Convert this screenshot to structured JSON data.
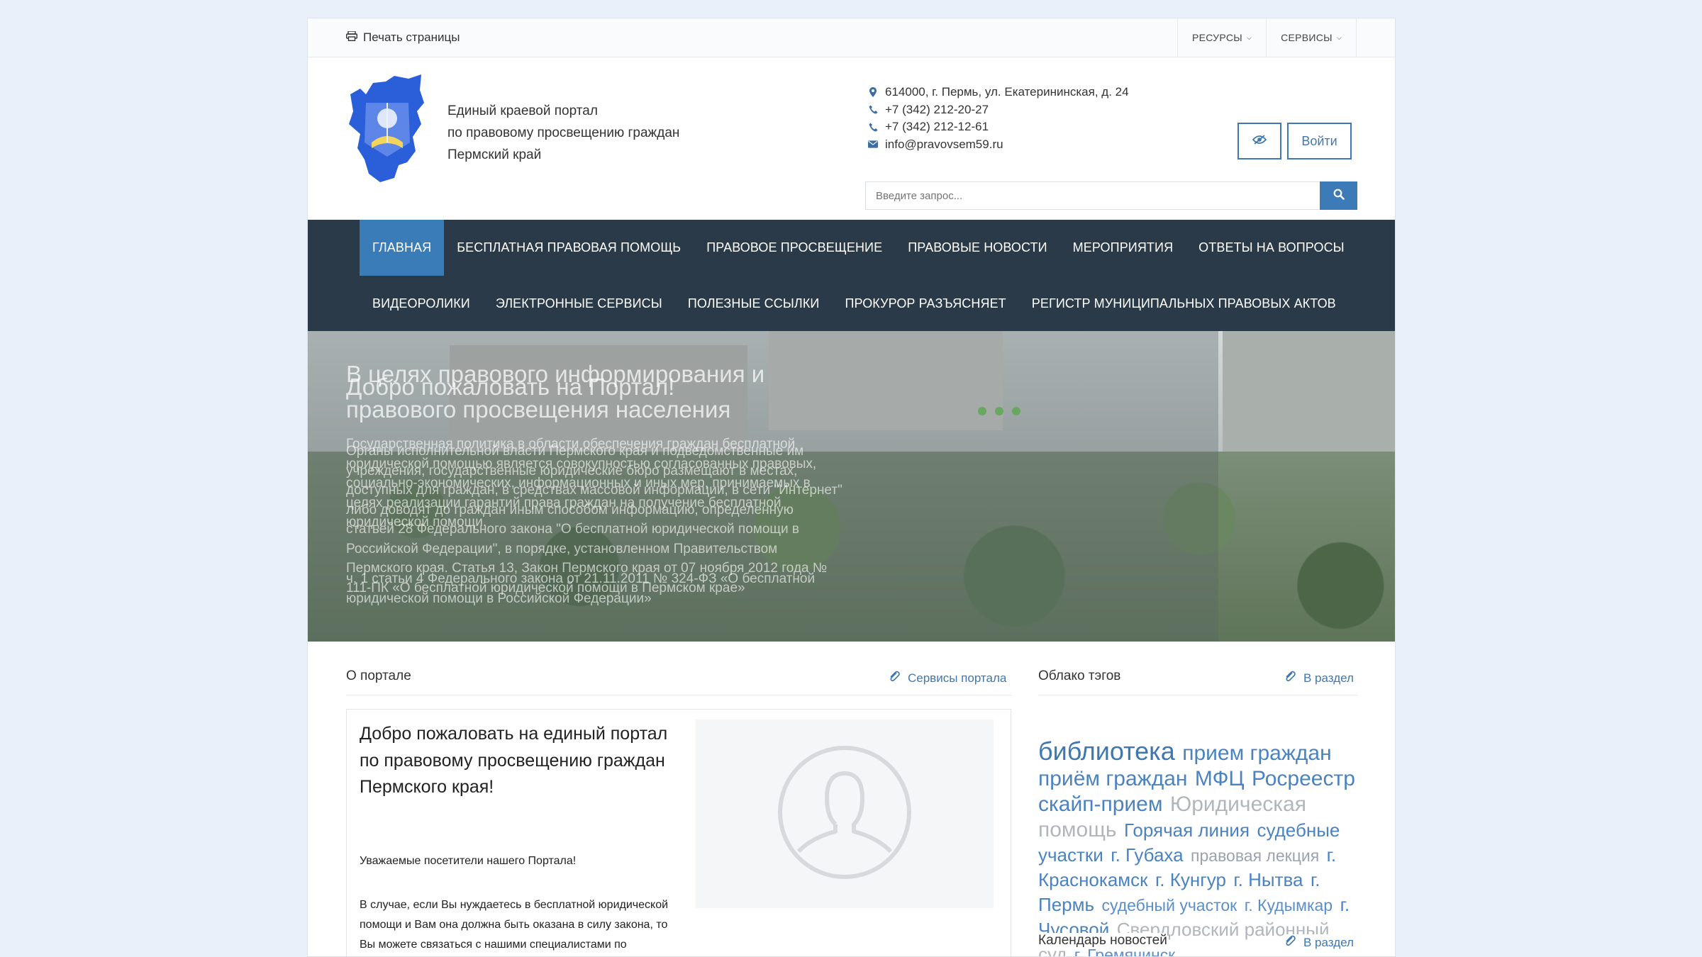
{
  "topbar": {
    "print_label": "Печать страницы",
    "menu": [
      {
        "label": "РЕСУРСЫ"
      },
      {
        "label": "СЕРВИСЫ"
      }
    ]
  },
  "header": {
    "portal_line1": "Единый краевой портал",
    "portal_line2": "по правовому просвещению граждан",
    "portal_line3": "Пермский край",
    "address": "614000, г. Пермь, ул. Екатерининская, д. 24",
    "phone1": "+7 (342) 212-20-27",
    "phone2": "+7 (342) 212-12-61",
    "email": "info@pravovsem59.ru",
    "login_label": "Войти",
    "search_placeholder": "Введите запрос..."
  },
  "nav": {
    "row1": [
      "ГЛАВНАЯ",
      "БЕСПЛАТНАЯ ПРАВОВАЯ ПОМОЩЬ",
      "ПРАВОВОЕ ПРОСВЕЩЕНИЕ",
      "ПРАВОВЫЕ НОВОСТИ",
      "МЕРОПРИЯТИЯ",
      "ОТВЕТЫ НА ВОПРОСЫ"
    ],
    "row2": [
      "ВИДЕОРОЛИКИ",
      "ЭЛЕКТРОННЫЕ СЕРВИСЫ",
      "ПОЛЕЗНЫЕ ССЫЛКИ",
      "ПРОКУРОР РАЗЪЯСНЯЕТ",
      "РЕГИСТР МУНИЦИПАЛЬНЫХ ПРАВОВЫХ АКТОВ"
    ]
  },
  "banner": {
    "title_a": "В целях правового информирования и правового просвещения населения",
    "title_b": "Добро пожаловать на Портал!",
    "text_a": "Государственная политика в области обеспечения граждан бесплатной юридической помощью является совокупностью согласованных правовых, социально-экономических, информационных и иных мер, принимаемых в целях реализации гарантий права граждан на получение бесплатной юридической помощи.",
    "text_b": "Органы исполнительной власти Пермского края и подведомственные им учреждения, государственные юридические бюро размещают в местах, доступных для граждан, в средствах массовой информации, в сети \"Интернет\" либо доводят до граждан иным способом информацию, определенную статьей 28 Федерального закона \"О бесплатной юридической помощи в Российской Федерации\", в порядке, установленном Правительством Пермского края. Статья 13, Закон Пермского края от 07 ноября 2012 года № 111-ПК «О бесплатной юридической помощи в Пермском крае»",
    "text_c": "ч. 1 статьи 4 Федерального закона от 21.11.2011 № 324-ФЗ «О бесплатной юридической помощи в Российской Федерации»"
  },
  "about": {
    "heading": "О портале",
    "link": "Сервисы портала",
    "welcome_title": "Добро пожаловать на единый портал по правовому просвещению граждан Пермского края!",
    "greeting": "Уважаемые посетители нашего Портала!",
    "body": "В случае, если Вы нуждаетесь в бесплатной юридической помощи и Вам она должна быть оказана в силу закона, то Вы можете связаться с нашими специалистами по телефонам, указанным в"
  },
  "tags": {
    "heading": "Облако тэгов",
    "link": "В раздел",
    "items": [
      {
        "text": "библиотека",
        "size": "xl"
      },
      {
        "text": "прием граждан",
        "size": "l"
      },
      {
        "text": "приём граждан",
        "size": "l"
      },
      {
        "text": "МФЦ",
        "size": "l"
      },
      {
        "text": "Росреестр",
        "size": "l"
      },
      {
        "text": "скайп-прием",
        "size": "l"
      },
      {
        "text": "Юридическая помощь",
        "size": "gray"
      },
      {
        "text": "Горячая линия",
        "size": "m"
      },
      {
        "text": "судебные участки",
        "size": "m"
      },
      {
        "text": "г. Губаха",
        "size": "m"
      },
      {
        "text": "правовая лекция",
        "size": "s"
      },
      {
        "text": "г. Краснокамск",
        "size": "m"
      },
      {
        "text": "г. Кунгур",
        "size": "m"
      },
      {
        "text": "г. Нытва",
        "size": "m"
      },
      {
        "text": "г. Пермь",
        "size": "m"
      },
      {
        "text": "судебный участок",
        "size": "s"
      },
      {
        "text": "г. Кудымкар",
        "size": "s"
      },
      {
        "text": "г. Чусовой",
        "size": "m"
      },
      {
        "text": "Свердловский районный суд",
        "size": "gray"
      },
      {
        "text": "г. Гремячинск",
        "size": "s"
      }
    ]
  },
  "calendar": {
    "heading": "Календарь новостей",
    "link": "В раздел"
  },
  "colors": {
    "nav_bg": "#2b3a49",
    "accent": "#3a7cb8",
    "page_bg": "#e9f0fa"
  }
}
